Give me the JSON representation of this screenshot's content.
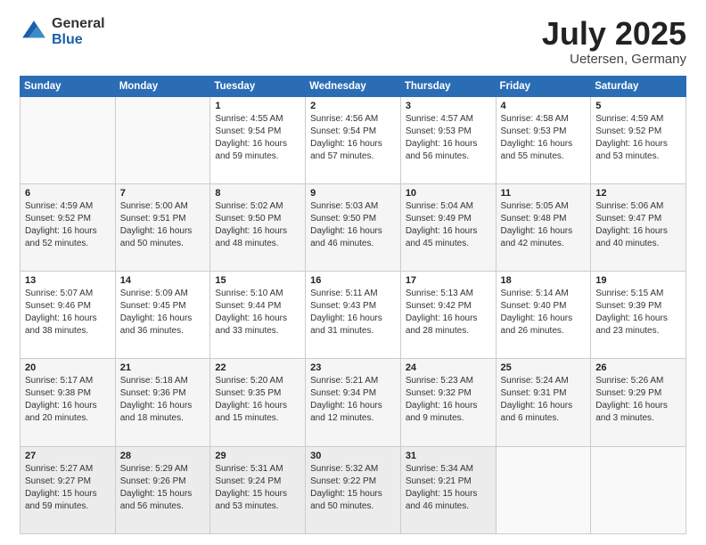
{
  "logo": {
    "general": "General",
    "blue": "Blue"
  },
  "title": "July 2025",
  "subtitle": "Uetersen, Germany",
  "header_days": [
    "Sunday",
    "Monday",
    "Tuesday",
    "Wednesday",
    "Thursday",
    "Friday",
    "Saturday"
  ],
  "weeks": [
    [
      {
        "day": "",
        "content": ""
      },
      {
        "day": "",
        "content": ""
      },
      {
        "day": "1",
        "content": "Sunrise: 4:55 AM\nSunset: 9:54 PM\nDaylight: 16 hours and 59 minutes."
      },
      {
        "day": "2",
        "content": "Sunrise: 4:56 AM\nSunset: 9:54 PM\nDaylight: 16 hours and 57 minutes."
      },
      {
        "day": "3",
        "content": "Sunrise: 4:57 AM\nSunset: 9:53 PM\nDaylight: 16 hours and 56 minutes."
      },
      {
        "day": "4",
        "content": "Sunrise: 4:58 AM\nSunset: 9:53 PM\nDaylight: 16 hours and 55 minutes."
      },
      {
        "day": "5",
        "content": "Sunrise: 4:59 AM\nSunset: 9:52 PM\nDaylight: 16 hours and 53 minutes."
      }
    ],
    [
      {
        "day": "6",
        "content": "Sunrise: 4:59 AM\nSunset: 9:52 PM\nDaylight: 16 hours and 52 minutes."
      },
      {
        "day": "7",
        "content": "Sunrise: 5:00 AM\nSunset: 9:51 PM\nDaylight: 16 hours and 50 minutes."
      },
      {
        "day": "8",
        "content": "Sunrise: 5:02 AM\nSunset: 9:50 PM\nDaylight: 16 hours and 48 minutes."
      },
      {
        "day": "9",
        "content": "Sunrise: 5:03 AM\nSunset: 9:50 PM\nDaylight: 16 hours and 46 minutes."
      },
      {
        "day": "10",
        "content": "Sunrise: 5:04 AM\nSunset: 9:49 PM\nDaylight: 16 hours and 45 minutes."
      },
      {
        "day": "11",
        "content": "Sunrise: 5:05 AM\nSunset: 9:48 PM\nDaylight: 16 hours and 42 minutes."
      },
      {
        "day": "12",
        "content": "Sunrise: 5:06 AM\nSunset: 9:47 PM\nDaylight: 16 hours and 40 minutes."
      }
    ],
    [
      {
        "day": "13",
        "content": "Sunrise: 5:07 AM\nSunset: 9:46 PM\nDaylight: 16 hours and 38 minutes."
      },
      {
        "day": "14",
        "content": "Sunrise: 5:09 AM\nSunset: 9:45 PM\nDaylight: 16 hours and 36 minutes."
      },
      {
        "day": "15",
        "content": "Sunrise: 5:10 AM\nSunset: 9:44 PM\nDaylight: 16 hours and 33 minutes."
      },
      {
        "day": "16",
        "content": "Sunrise: 5:11 AM\nSunset: 9:43 PM\nDaylight: 16 hours and 31 minutes."
      },
      {
        "day": "17",
        "content": "Sunrise: 5:13 AM\nSunset: 9:42 PM\nDaylight: 16 hours and 28 minutes."
      },
      {
        "day": "18",
        "content": "Sunrise: 5:14 AM\nSunset: 9:40 PM\nDaylight: 16 hours and 26 minutes."
      },
      {
        "day": "19",
        "content": "Sunrise: 5:15 AM\nSunset: 9:39 PM\nDaylight: 16 hours and 23 minutes."
      }
    ],
    [
      {
        "day": "20",
        "content": "Sunrise: 5:17 AM\nSunset: 9:38 PM\nDaylight: 16 hours and 20 minutes."
      },
      {
        "day": "21",
        "content": "Sunrise: 5:18 AM\nSunset: 9:36 PM\nDaylight: 16 hours and 18 minutes."
      },
      {
        "day": "22",
        "content": "Sunrise: 5:20 AM\nSunset: 9:35 PM\nDaylight: 16 hours and 15 minutes."
      },
      {
        "day": "23",
        "content": "Sunrise: 5:21 AM\nSunset: 9:34 PM\nDaylight: 16 hours and 12 minutes."
      },
      {
        "day": "24",
        "content": "Sunrise: 5:23 AM\nSunset: 9:32 PM\nDaylight: 16 hours and 9 minutes."
      },
      {
        "day": "25",
        "content": "Sunrise: 5:24 AM\nSunset: 9:31 PM\nDaylight: 16 hours and 6 minutes."
      },
      {
        "day": "26",
        "content": "Sunrise: 5:26 AM\nSunset: 9:29 PM\nDaylight: 16 hours and 3 minutes."
      }
    ],
    [
      {
        "day": "27",
        "content": "Sunrise: 5:27 AM\nSunset: 9:27 PM\nDaylight: 15 hours and 59 minutes."
      },
      {
        "day": "28",
        "content": "Sunrise: 5:29 AM\nSunset: 9:26 PM\nDaylight: 15 hours and 56 minutes."
      },
      {
        "day": "29",
        "content": "Sunrise: 5:31 AM\nSunset: 9:24 PM\nDaylight: 15 hours and 53 minutes."
      },
      {
        "day": "30",
        "content": "Sunrise: 5:32 AM\nSunset: 9:22 PM\nDaylight: 15 hours and 50 minutes."
      },
      {
        "day": "31",
        "content": "Sunrise: 5:34 AM\nSunset: 9:21 PM\nDaylight: 15 hours and 46 minutes."
      },
      {
        "day": "",
        "content": ""
      },
      {
        "day": "",
        "content": ""
      }
    ]
  ]
}
